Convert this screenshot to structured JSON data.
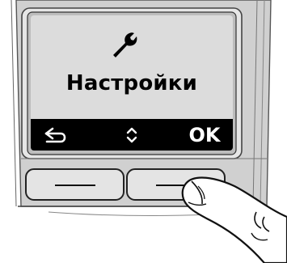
{
  "screen": {
    "icon": "wrench-icon",
    "title": "Настройки"
  },
  "softkeys": {
    "left_icon": "back-arrow-icon",
    "middle_icon": "up-down-chevron-icon",
    "right_label": "OK"
  },
  "colors": {
    "screen_background": "#dcdcdc",
    "softkey_bar": "#000000",
    "handset_silver": "#cfcfcf"
  }
}
